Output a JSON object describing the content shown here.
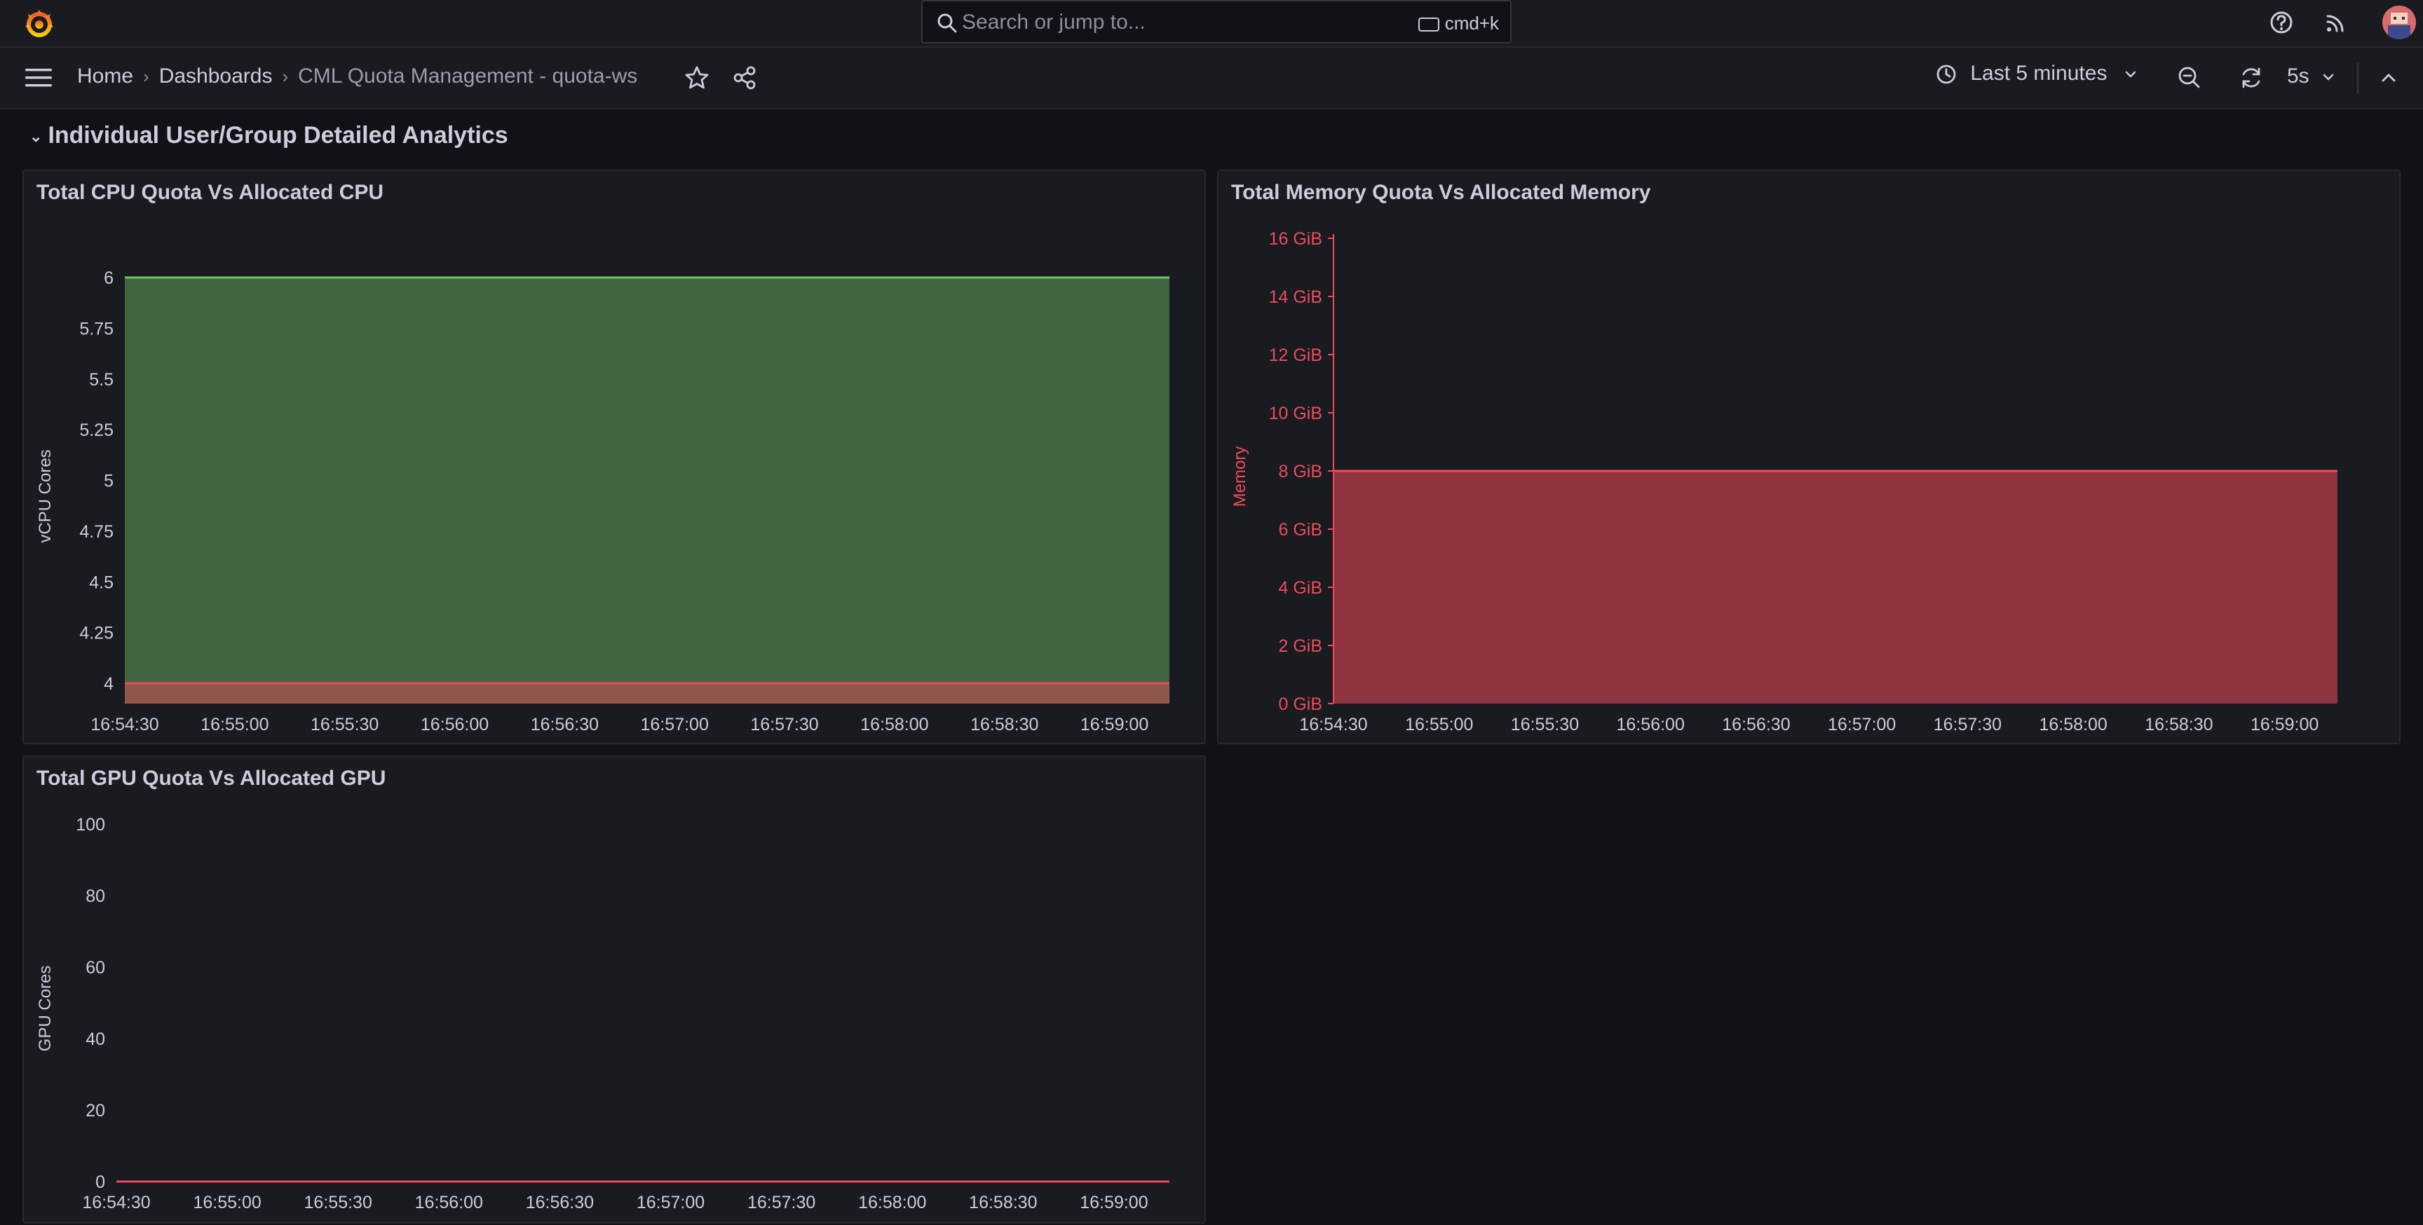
{
  "search": {
    "placeholder": "Search or jump to...",
    "shortcut": "cmd+k"
  },
  "breadcrumb": {
    "home": "Home",
    "dashboards": "Dashboards",
    "current": "CML Quota Management - quota-ws"
  },
  "toolbar": {
    "time_range": "Last 5 minutes",
    "refresh_interval": "5s"
  },
  "row": {
    "title": "Individual User/Group Detailed Analytics"
  },
  "colors": {
    "green": "#73bf69",
    "red": "#f2495c",
    "background": "#111217",
    "panel": "#181b1f"
  },
  "panels": {
    "cpu": {
      "title": "Total CPU Quota Vs Allocated CPU"
    },
    "memory": {
      "title": "Total Memory Quota Vs Allocated Memory"
    },
    "gpu": {
      "title": "Total GPU Quota Vs Allocated GPU"
    }
  },
  "chart_data": [
    {
      "id": "cpu",
      "type": "area",
      "title": "Total CPU Quota Vs Allocated CPU",
      "ylabel": "vCPU Cores",
      "xlabel": "",
      "ylim": [
        3.9,
        6.0
      ],
      "y_ticks": [
        4,
        4.25,
        4.5,
        4.75,
        5,
        5.25,
        5.5,
        5.75,
        6
      ],
      "y_tick_labels": [
        "4",
        "4.25",
        "4.5",
        "4.75",
        "5",
        "5.25",
        "5.5",
        "5.75",
        "6"
      ],
      "x_tick_labels": [
        "16:54:30",
        "16:55:00",
        "16:55:30",
        "16:56:00",
        "16:56:30",
        "16:57:00",
        "16:57:30",
        "16:58:00",
        "16:58:30",
        "16:59:00"
      ],
      "x_start": "16:54:30",
      "x_end": "16:59:15",
      "grid": false,
      "series": [
        {
          "values": [
            6,
            6
          ],
          "color": "#73bf69"
        },
        {
          "values": [
            4,
            4
          ],
          "color": "#f2495c"
        }
      ]
    },
    {
      "id": "memory",
      "type": "area",
      "title": "Total Memory Quota Vs Allocated Memory",
      "ylabel": "Memory",
      "xlabel": "",
      "ylim": [
        0,
        16
      ],
      "y_ticks": [
        0,
        2,
        4,
        6,
        8,
        10,
        12,
        14,
        16
      ],
      "y_tick_labels": [
        "0 GiB",
        "2 GiB",
        "4 GiB",
        "6 GiB",
        "8 GiB",
        "10 GiB",
        "12 GiB",
        "14 GiB",
        "16 GiB"
      ],
      "x_tick_labels": [
        "16:54:30",
        "16:55:00",
        "16:55:30",
        "16:56:00",
        "16:56:30",
        "16:57:00",
        "16:57:30",
        "16:58:00",
        "16:58:30",
        "16:59:00"
      ],
      "x_start": "16:54:30",
      "x_end": "16:59:15",
      "grid": false,
      "series": [
        {
          "values": [
            8,
            8
          ],
          "color": "#f2495c"
        }
      ]
    },
    {
      "id": "gpu",
      "type": "line",
      "title": "Total GPU Quota Vs Allocated GPU",
      "ylabel": "GPU Cores",
      "xlabel": "",
      "ylim": [
        0,
        100
      ],
      "y_ticks": [
        0,
        20,
        40,
        60,
        80,
        100
      ],
      "y_tick_labels": [
        "0",
        "20",
        "40",
        "60",
        "80",
        "100"
      ],
      "x_tick_labels": [
        "16:54:30",
        "16:55:00",
        "16:55:30",
        "16:56:00",
        "16:56:30",
        "16:57:00",
        "16:57:30",
        "16:58:00",
        "16:58:30",
        "16:59:00"
      ],
      "x_start": "16:54:30",
      "x_end": "16:59:15",
      "grid": false,
      "series": [
        {
          "values": [
            0,
            0
          ],
          "color": "#f2495c"
        }
      ]
    }
  ]
}
